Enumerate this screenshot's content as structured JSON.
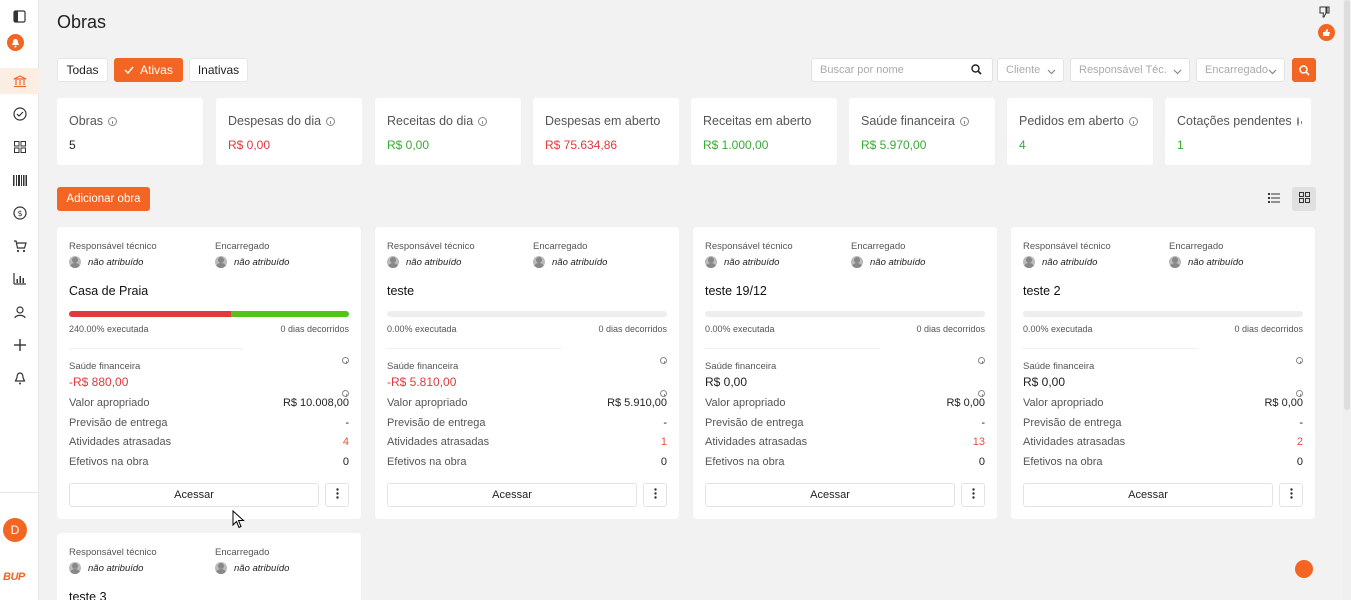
{
  "page": {
    "title": "Obras"
  },
  "filters": {
    "all": "Todas",
    "active": "Ativas",
    "inactive": "Inativas"
  },
  "search": {
    "placeholder": "Buscar por nome"
  },
  "selects": {
    "client": "Cliente",
    "tech": "Responsável Téc.",
    "foreman": "Encarregado"
  },
  "kpis": [
    {
      "label": "Obras",
      "value": "5",
      "info": true,
      "tone": ""
    },
    {
      "label": "Despesas do dia",
      "value": "R$ 0,00",
      "info": true,
      "tone": "red"
    },
    {
      "label": "Receitas do dia",
      "value": "R$ 0,00",
      "info": true,
      "tone": "green"
    },
    {
      "label": "Despesas em aberto",
      "value": "R$ 75.634,86",
      "info": false,
      "tone": "red"
    },
    {
      "label": "Receitas em aberto",
      "value": "R$ 1.000,00",
      "info": false,
      "tone": "green"
    },
    {
      "label": "Saúde financeira",
      "value": "R$ 5.970,00",
      "info": true,
      "tone": "green"
    },
    {
      "label": "Pedidos em aberto",
      "value": "4",
      "info": true,
      "tone": "green"
    },
    {
      "label": "Cotações pendentes",
      "value": "1",
      "info": true,
      "tone": "green"
    }
  ],
  "actions": {
    "add_label": "Adicionar obra"
  },
  "card_labels": {
    "tech": "Responsável técnico",
    "foreman": "Encarregado",
    "unassigned": "não atribuído",
    "health": "Saúde financeira",
    "value": "Valor apropriado",
    "forecast": "Previsão de entrega",
    "late": "Atividades atrasadas",
    "staff": "Efetivos na obra",
    "access": "Acessar"
  },
  "cards": [
    {
      "name": "Casa de Praia",
      "executed": "240.00% executada",
      "executed_fraction": 1.0,
      "red_fraction": 0.58,
      "days": "0 dias decorridos",
      "health": "-R$ 880,00",
      "health_tone": "red",
      "value": "R$ 10.008,00",
      "forecast": "-",
      "late": "4",
      "staff": "0"
    },
    {
      "name": "teste",
      "executed": "0.00% executada",
      "executed_fraction": 0,
      "red_fraction": 0,
      "days": "0 dias decorridos",
      "health": "-R$ 5.810,00",
      "health_tone": "red",
      "value": "R$ 5.910,00",
      "forecast": "-",
      "late": "1",
      "staff": "0"
    },
    {
      "name": "teste 19/12",
      "executed": "0.00% executada",
      "executed_fraction": 0,
      "red_fraction": 0,
      "days": "0 dias decorridos",
      "health": "R$ 0,00",
      "health_tone": "",
      "value": "R$ 0,00",
      "forecast": "-",
      "late": "13",
      "staff": "0"
    },
    {
      "name": "teste 2",
      "executed": "0.00% executada",
      "executed_fraction": 0,
      "red_fraction": 0,
      "days": "0 dias decorridos",
      "health": "R$ 0,00",
      "health_tone": "",
      "value": "R$ 0,00",
      "forecast": "-",
      "late": "2",
      "staff": "0"
    },
    {
      "name": "teste 3"
    }
  ],
  "user": {
    "initial": "D"
  },
  "brand": {
    "logo_text": "BUP"
  },
  "colors": {
    "accent": "#f26522",
    "negative": "#e0393e",
    "positive": "#3aa935"
  }
}
